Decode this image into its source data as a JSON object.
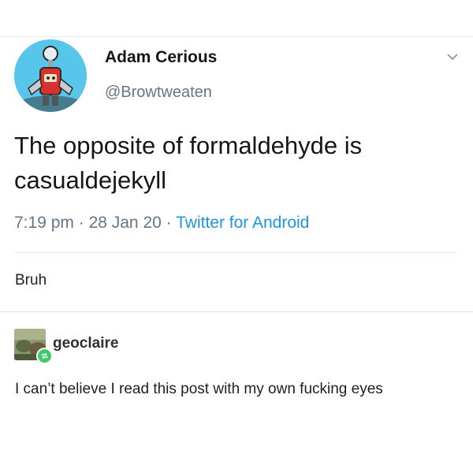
{
  "tweet": {
    "display_name": "Adam Cerious",
    "handle": "@Browtweaten",
    "text": "The opposite of formaldehyde is casualdejekyll",
    "time": "7:19 pm",
    "separator": " · ",
    "date": "28 Jan 20",
    "source": "Twitter for Android"
  },
  "reply": {
    "text": "Bruh"
  },
  "reblog": {
    "username": "geoclaire",
    "text": "I can’t believe I read this post with my own fucking eyes"
  },
  "colors": {
    "avatar_bg": "#58c6ea",
    "secondary_text": "#657786",
    "link": "#1b95e0",
    "reblog_badge": "#3fc96b"
  },
  "icons": {
    "avatar": "robot-avatar-icon",
    "menu": "chevron-down-icon",
    "reblog": "reblog-icon"
  }
}
